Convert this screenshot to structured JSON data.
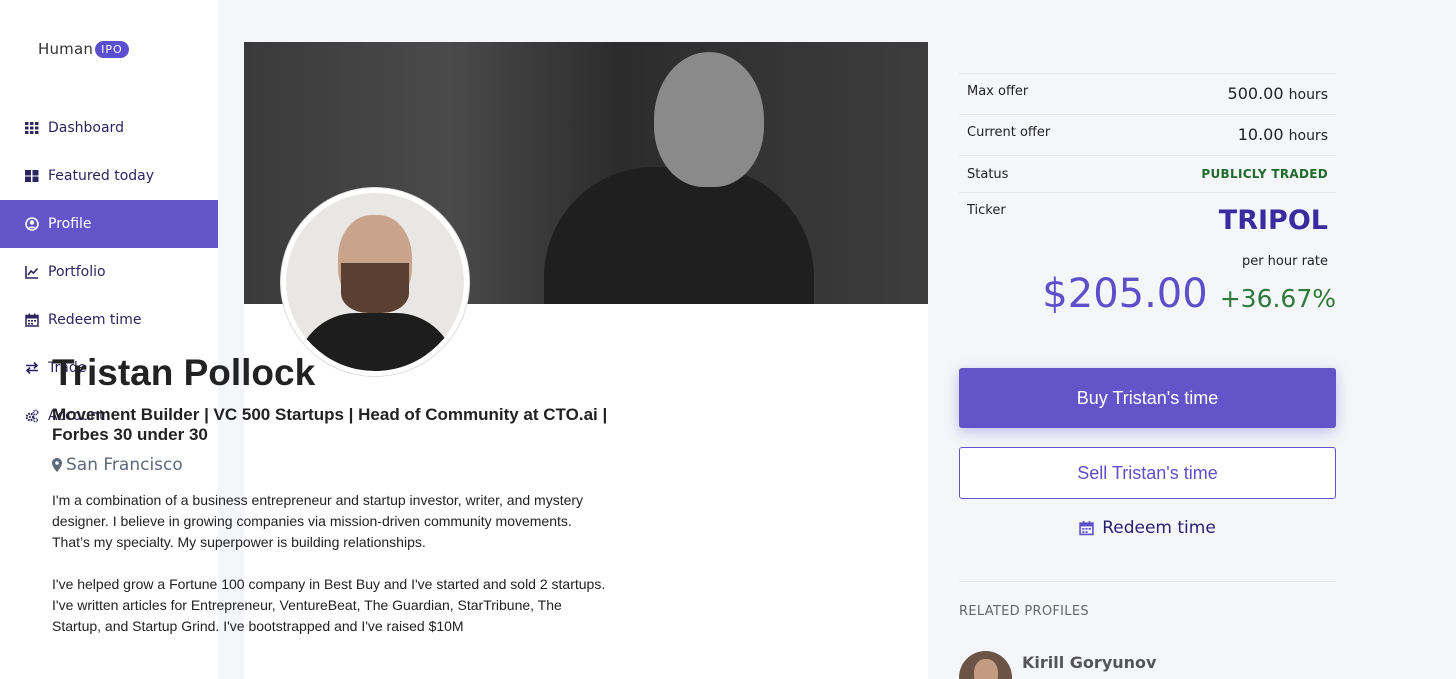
{
  "logo": {
    "text": "Human",
    "badge": "IPO"
  },
  "nav": {
    "items": [
      {
        "label": "Dashboard",
        "icon": "grid-icon"
      },
      {
        "label": "Featured today",
        "icon": "tiles-icon"
      },
      {
        "label": "Profile",
        "icon": "user-circle-icon",
        "active": true
      },
      {
        "label": "Portfolio",
        "icon": "line-chart-icon"
      },
      {
        "label": "Redeem time",
        "icon": "calendar-icon"
      },
      {
        "label": "Trade",
        "icon": "exchange-icon"
      },
      {
        "label": "Account",
        "icon": "gears-icon"
      }
    ]
  },
  "profile": {
    "name": "Tristan Pollock",
    "headline": "Movement Builder | VC 500 Startups | Head of Community at CTO.ai | Forbes 30 under 30",
    "location": "San Francisco",
    "bio": [
      "I'm a combination of a business entrepreneur and startup investor, writer, and mystery designer. I believe in growing companies via mission-driven community movements. That’s my specialty. My superpower is building relationships.",
      "I've helped grow a Fortune 100 company in Best Buy and I've started and sold 2 startups. I've written articles for Entrepreneur, VentureBeat, The Guardian, StarTribune, The Startup, and Startup Grind. I've bootstrapped and I've raised $10M"
    ]
  },
  "stats": {
    "max_offer_label": "Max offer",
    "max_offer_value": "500.00",
    "max_offer_unit": "hours",
    "current_offer_label": "Current offer",
    "current_offer_value": "10.00",
    "current_offer_unit": "hours",
    "status_label": "Status",
    "status_value": "PUBLICLY TRADED",
    "ticker_label": "Ticker",
    "ticker_value": "TRIPOL",
    "rate_label": "per hour rate",
    "price": "$205.00",
    "change": "+36.67%"
  },
  "actions": {
    "buy_label": "Buy Tristan's time",
    "sell_label": "Sell Tristan's time",
    "redeem_label": "Redeem time"
  },
  "related": {
    "title": "RELATED PROFILES",
    "items": [
      {
        "name": "Kirill Goryunov"
      }
    ]
  },
  "colors": {
    "accent": "#6553c9",
    "ticker": "#3b2aa0",
    "status_green": "#1e6b2c",
    "change_green": "#2e7a3a"
  }
}
